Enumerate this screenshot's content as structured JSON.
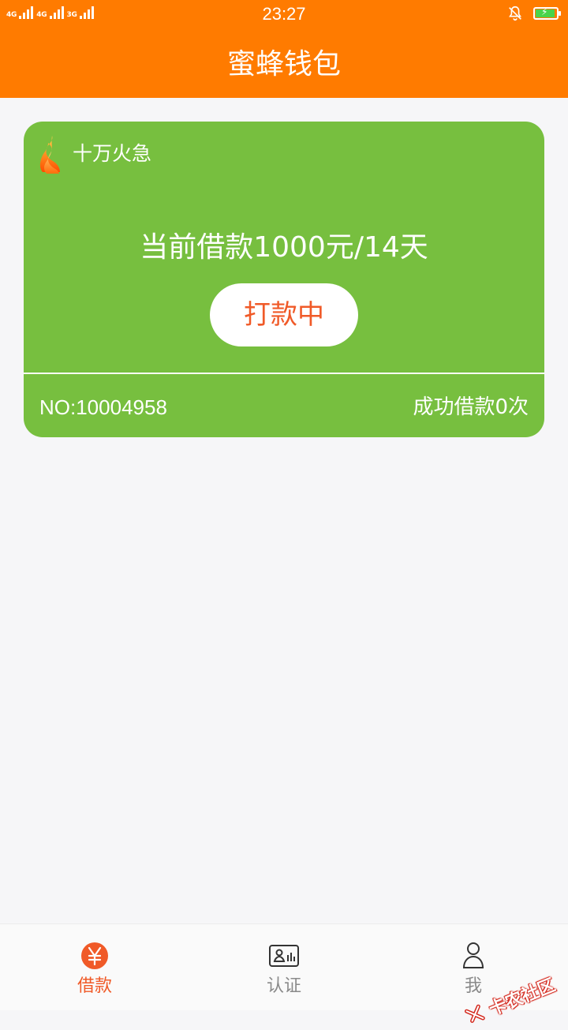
{
  "status_bar": {
    "time": "23:27",
    "networks": [
      "4G",
      "4G",
      "3G"
    ],
    "bell_icon": "bell-off-icon",
    "battery_icon": "battery-charging-icon"
  },
  "app": {
    "title": "蜜蜂钱包"
  },
  "card": {
    "tag_label": "十万火急",
    "summary": "当前借款1000元/14天",
    "status_button": "打款中",
    "number": "NO:10004958",
    "success_count": "成功借款0次"
  },
  "tabs": [
    {
      "label": "借款",
      "icon": "yuan-icon",
      "active": true
    },
    {
      "label": "认证",
      "icon": "id-card-icon",
      "active": false
    },
    {
      "label": "我",
      "icon": "person-icon",
      "active": false
    }
  ],
  "watermark": {
    "text": "卡农社区"
  },
  "colors": {
    "header": "#ff7b00",
    "card": "#77bf3f",
    "accent": "#f05a28",
    "background": "#f6f6f8"
  }
}
